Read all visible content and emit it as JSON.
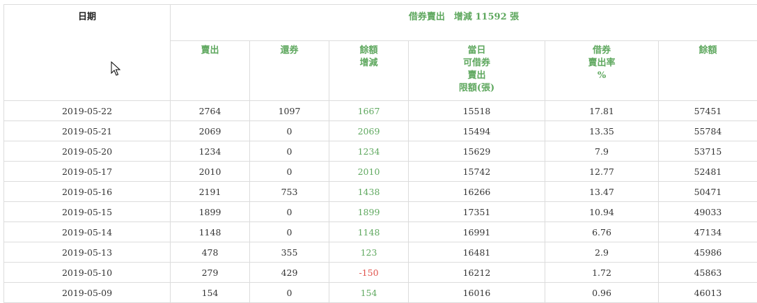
{
  "colors": {
    "header_green": "#5fa85f",
    "negative_red": "#e0524b",
    "text": "#333333",
    "border": "#dcdcdc"
  },
  "header": {
    "group_title": "借券賣出　增減 11592 張",
    "date": "日期",
    "sell": "賣出",
    "return": "還券",
    "balance_change": [
      "餘額",
      "增減"
    ],
    "daily_limit": [
      "當日",
      "可借券",
      "賣出",
      "限額(張)"
    ],
    "sell_rate": [
      "借券",
      "賣出率",
      "%"
    ],
    "balance": "餘額"
  },
  "rows": [
    {
      "date": "2019-05-22",
      "sell": "2764",
      "return": "1097",
      "change": "1667",
      "limit": "15518",
      "rate": "17.81",
      "balance": "57451"
    },
    {
      "date": "2019-05-21",
      "sell": "2069",
      "return": "0",
      "change": "2069",
      "limit": "15494",
      "rate": "13.35",
      "balance": "55784"
    },
    {
      "date": "2019-05-20",
      "sell": "1234",
      "return": "0",
      "change": "1234",
      "limit": "15629",
      "rate": "7.9",
      "balance": "53715"
    },
    {
      "date": "2019-05-17",
      "sell": "2010",
      "return": "0",
      "change": "2010",
      "limit": "15742",
      "rate": "12.77",
      "balance": "52481"
    },
    {
      "date": "2019-05-16",
      "sell": "2191",
      "return": "753",
      "change": "1438",
      "limit": "16266",
      "rate": "13.47",
      "balance": "50471"
    },
    {
      "date": "2019-05-15",
      "sell": "1899",
      "return": "0",
      "change": "1899",
      "limit": "17351",
      "rate": "10.94",
      "balance": "49033"
    },
    {
      "date": "2019-05-14",
      "sell": "1148",
      "return": "0",
      "change": "1148",
      "limit": "16991",
      "rate": "6.76",
      "balance": "47134"
    },
    {
      "date": "2019-05-13",
      "sell": "478",
      "return": "355",
      "change": "123",
      "limit": "16481",
      "rate": "2.9",
      "balance": "45986"
    },
    {
      "date": "2019-05-10",
      "sell": "279",
      "return": "429",
      "change": "-150",
      "limit": "16212",
      "rate": "1.72",
      "balance": "45863"
    },
    {
      "date": "2019-05-09",
      "sell": "154",
      "return": "0",
      "change": "154",
      "limit": "16016",
      "rate": "0.96",
      "balance": "46013"
    }
  ]
}
